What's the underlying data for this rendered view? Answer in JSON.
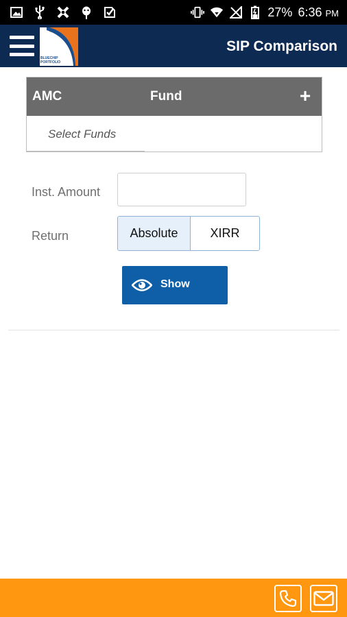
{
  "status_bar": {
    "battery": "27%",
    "time": "6:36",
    "ampm": "PM",
    "left_icons": [
      "image-icon",
      "usb-icon",
      "cross-icon",
      "debug-icon",
      "checkmark-badge-icon"
    ],
    "right_icons": [
      "vibrate-icon",
      "wifi-icon",
      "no-sim-icon",
      "battery-icon"
    ]
  },
  "app_bar": {
    "title": "SIP Comparison",
    "logo_text_line1": "BLUECHIP",
    "logo_text_line2": "PORTFOLIO"
  },
  "funds_table": {
    "col_amc": "AMC",
    "col_fund": "Fund",
    "add_symbol": "+",
    "select_funds_placeholder": "Select Funds"
  },
  "form": {
    "inst_amount_label": "Inst. Amount",
    "inst_amount_value": "",
    "return_label": "Return",
    "return_options": [
      "Absolute",
      "XIRR"
    ],
    "return_selected": "Absolute"
  },
  "show_button": {
    "label": "Show"
  },
  "colors": {
    "app_bar": "#0d2a52",
    "table_header": "#6b6b6b",
    "show_button": "#0f5fa8",
    "bottom_bar": "#ff9710",
    "logo_accent": "#e8731c"
  }
}
